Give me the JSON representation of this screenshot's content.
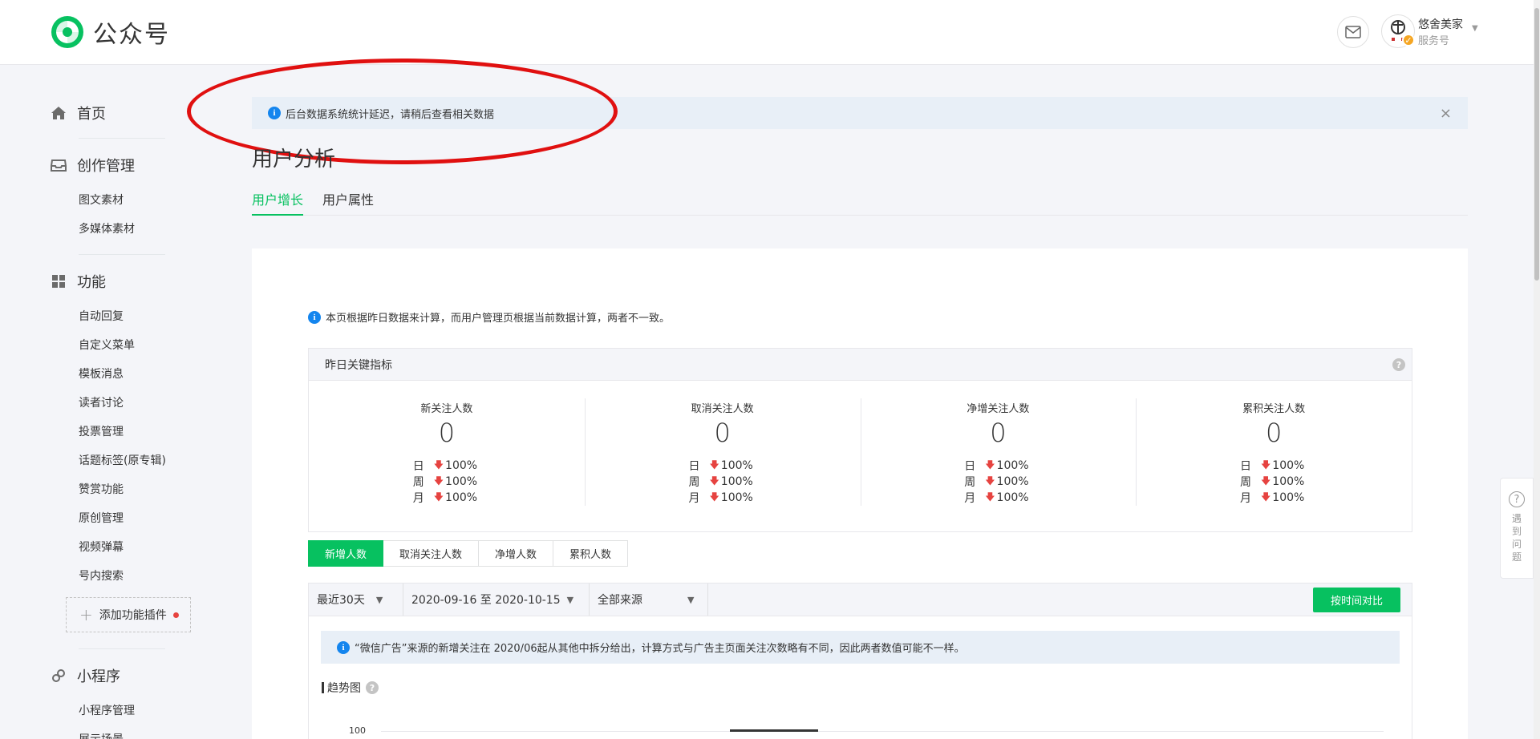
{
  "header": {
    "logo_text": "公众号",
    "account_name": "悠舍美家",
    "account_type": "服务号",
    "icons": {
      "logo": "wechat-logo-icon",
      "mail": "mail-icon",
      "verify": "verified-badge-icon",
      "caret": "caret-down-icon"
    }
  },
  "sidebar": {
    "groups": [
      {
        "label": "首页",
        "icon": "home-icon",
        "items": []
      },
      {
        "label": "创作管理",
        "icon": "inbox-icon",
        "items": [
          "图文素材",
          "多媒体素材"
        ]
      },
      {
        "label": "功能",
        "icon": "grid-icon",
        "items": [
          "自动回复",
          "自定义菜单",
          "模板消息",
          "读者讨论",
          "投票管理",
          "话题标签(原专辑)",
          "赞赏功能",
          "原创管理",
          "视频弹幕",
          "号内搜索"
        ]
      },
      {
        "label": "小程序",
        "icon": "link-icon",
        "items": [
          "小程序管理",
          "展示场景"
        ]
      }
    ],
    "add_plugin_label": "添加功能插件"
  },
  "notice": {
    "text": "后台数据系统统计延迟，请稍后查看相关数据",
    "close": "×"
  },
  "page_title": "用户分析",
  "tabs": [
    {
      "label": "用户增长",
      "active": true
    },
    {
      "label": "用户属性",
      "active": false
    }
  ],
  "card": {
    "tip": "本页根据昨日数据来计算，而用户管理页根据当前数据计算，两者不一致。",
    "kpi_title": "昨日关键指标",
    "kpis": [
      {
        "label": "新关注人数",
        "value": "0",
        "rows": [
          [
            "日",
            "100%"
          ],
          [
            "周",
            "100%"
          ],
          [
            "月",
            "100%"
          ]
        ]
      },
      {
        "label": "取消关注人数",
        "value": "0",
        "rows": [
          [
            "日",
            "100%"
          ],
          [
            "周",
            "100%"
          ],
          [
            "月",
            "100%"
          ]
        ]
      },
      {
        "label": "净增关注人数",
        "value": "0",
        "rows": [
          [
            "日",
            "100%"
          ],
          [
            "周",
            "100%"
          ],
          [
            "月",
            "100%"
          ]
        ]
      },
      {
        "label": "累积关注人数",
        "value": "0",
        "rows": [
          [
            "日",
            "100%"
          ],
          [
            "周",
            "100%"
          ],
          [
            "月",
            "100%"
          ]
        ]
      }
    ],
    "segments": [
      "新增人数",
      "取消关注人数",
      "净增人数",
      "累积人数"
    ],
    "active_segment": 0,
    "filters": {
      "period": "最近30天",
      "date_range": "2020-09-16 至 2020-10-15",
      "source": "全部来源"
    },
    "compare_button": "按时间对比",
    "chart_note": "“微信广告”来源的新增关注在 2020/06起从其他中拆分给出，计算方式与广告主页面关注次数略有不同，因此两者数值可能不一样。",
    "trend_title": "趋势图",
    "y_tick_top": "100"
  },
  "float_help": {
    "text": "遇到问题"
  },
  "colors": {
    "brand_green": "#07c160",
    "info_blue": "#1485ee",
    "down_red": "#e64340",
    "annotation_red": "#e01010"
  }
}
